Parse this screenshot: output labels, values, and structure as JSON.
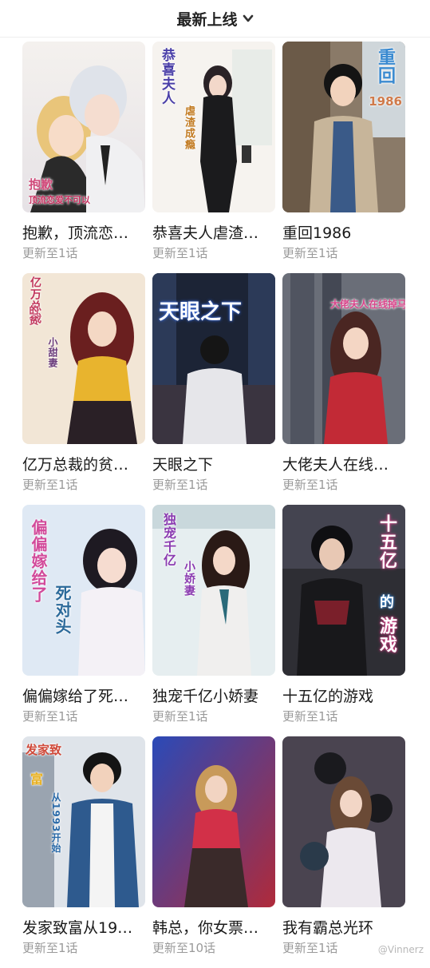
{
  "header": {
    "title": "最新上线"
  },
  "cards": [
    {
      "title": "抱歉，顶流恋…",
      "status": "更新至1话",
      "cover_text": [
        "抱歉",
        "顶流恋爱不可以"
      ]
    },
    {
      "title": "恭喜夫人虐渣…",
      "status": "更新至1话",
      "cover_text": [
        "恭喜夫人",
        "虐渣成瘾"
      ]
    },
    {
      "title": "重回1986",
      "status": "更新至1话",
      "cover_text": [
        "重回",
        "1986"
      ]
    },
    {
      "title": "亿万总裁的贫…",
      "status": "更新至1话",
      "cover_text": [
        "亿万总裁",
        "的贫",
        "小甜妻"
      ]
    },
    {
      "title": "天眼之下",
      "status": "更新至1话",
      "cover_text": [
        "天眼之下"
      ]
    },
    {
      "title": "大佬夫人在线…",
      "status": "更新至1话",
      "cover_text": [
        "大佬夫人在线掉马"
      ]
    },
    {
      "title": "偏偏嫁给了死…",
      "status": "更新至1话",
      "cover_text": [
        "偏偏嫁给了",
        "死对头"
      ]
    },
    {
      "title": "独宠千亿小娇妻",
      "status": "更新至1话",
      "cover_text": [
        "独宠千亿",
        "小娇妻"
      ]
    },
    {
      "title": "十五亿的游戏",
      "status": "更新至1话",
      "cover_text": [
        "十五亿",
        "的",
        "游戏"
      ]
    },
    {
      "title": "发家致富从19…",
      "status": "更新至1话",
      "cover_text": [
        "发家致",
        "富",
        "从1993开始"
      ]
    },
    {
      "title": "韩总，你女票…",
      "status": "更新至10话",
      "cover_text": []
    },
    {
      "title": "我有霸总光环",
      "status": "更新至1话",
      "cover_text": []
    }
  ],
  "watermark": "@Vinnerz",
  "colors": {
    "title": "#1a1a1a",
    "status": "#9a9a9a",
    "background": "#ffffff"
  },
  "icons": {
    "header_dropdown": "chevron-down-icon"
  }
}
